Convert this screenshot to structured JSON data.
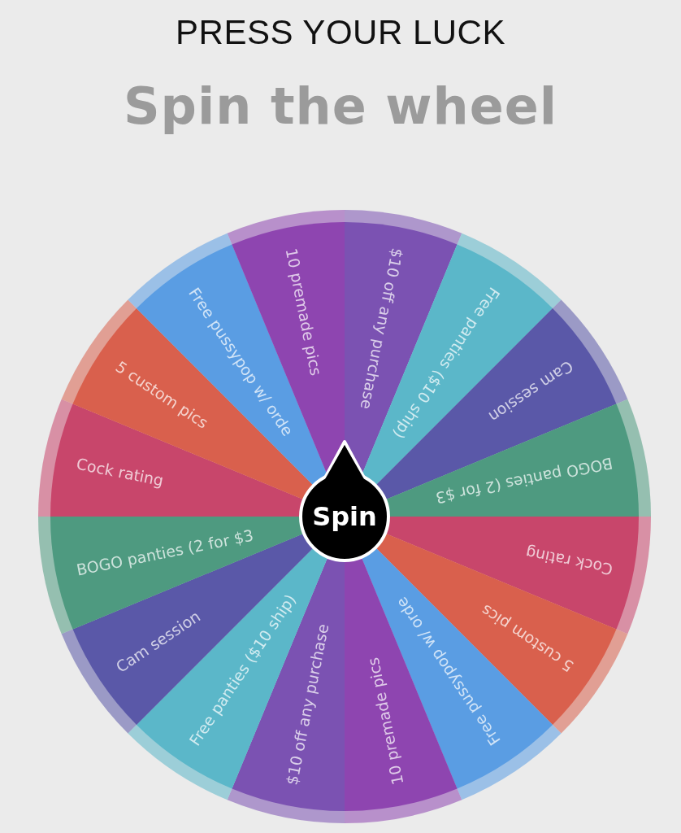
{
  "header": {
    "tagline": "PRESS YOUR LUCK",
    "title": "Spin the wheel"
  },
  "wheel": {
    "button": "Spin",
    "segments": [
      {
        "label": "$10 off any purchase",
        "color": "#7b52b2"
      },
      {
        "label": "Free panties ($10 ship)",
        "color": "#5bb7c9"
      },
      {
        "label": "Cam session",
        "color": "#5a58a8"
      },
      {
        "label": "BOGO panties (2 for $3",
        "color": "#4e9a80"
      },
      {
        "label": "Cock rating",
        "color": "#c8466b"
      },
      {
        "label": "5 custom pics",
        "color": "#d9604d"
      },
      {
        "label": "Free pussypop w/ orde",
        "color": "#5a9de3"
      },
      {
        "label": "10 premade pics",
        "color": "#8e45b0"
      },
      {
        "label": "$10 off any purchase",
        "color": "#7b52b2"
      },
      {
        "label": "Free panties ($10 ship)",
        "color": "#5bb7c9"
      },
      {
        "label": "Cam session",
        "color": "#5a58a8"
      },
      {
        "label": "BOGO panties (2 for $3",
        "color": "#4e9a80"
      },
      {
        "label": "Cock rating",
        "color": "#c8466b"
      },
      {
        "label": "5 custom pics",
        "color": "#d9604d"
      },
      {
        "label": "Free pussypop w/ orde",
        "color": "#5a9de3"
      },
      {
        "label": "10 premade pics",
        "color": "#8e45b0"
      }
    ]
  }
}
